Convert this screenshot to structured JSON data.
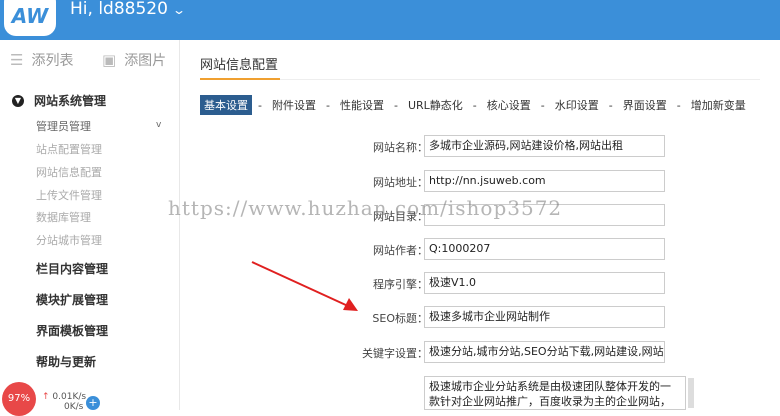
{
  "topbar": {
    "logo_text": "AW",
    "greeting": "Hi, ld88520",
    "chevron": "⌄"
  },
  "sidebar": {
    "quick_links": [
      {
        "label": "添列表",
        "icon": "list-icon"
      },
      {
        "label": "添图片",
        "icon": "image-icon"
      }
    ],
    "active_menu": {
      "label": "网站系统管理",
      "icon": "chevron-circle-icon",
      "items": [
        "管理员管理",
        "站点配置管理",
        "网站信息配置",
        "上传文件管理",
        "数据库管理",
        "分站城市管理"
      ],
      "marker": "v"
    },
    "groups": [
      "栏目内容管理",
      "模块扩展管理",
      "界面模板管理",
      "帮助与更新"
    ]
  },
  "status": {
    "percent": "97%",
    "speed": "0.01K/s",
    "speed2": "0K/s"
  },
  "main": {
    "title": "网站信息配置",
    "tabs": [
      "基本设置",
      "附件设置",
      "性能设置",
      "URL静态化",
      "核心设置",
      "水印设置",
      "界面设置",
      "增加新变量"
    ],
    "tab_sep": "-",
    "fields": [
      {
        "label": "网站名称：",
        "value": "多城市企业源码,网站建设价格,网站出租"
      },
      {
        "label": "网站地址：",
        "value": "http://nn.jsuweb.com"
      },
      {
        "label": "网站目录：",
        "value": ""
      },
      {
        "label": "网站作者：",
        "value": "Q:1000207"
      },
      {
        "label": "程序引擎：",
        "value": "极速V1.0"
      },
      {
        "label": "SEO标题：",
        "value": "极速多城市企业网站制作"
      },
      {
        "label": "关键字设置：",
        "value": "极速分站,城市分站,SEO分站下载,网站建设,网站推广"
      }
    ],
    "description": "极速城市企业分站系统是由极速团队整体开发的一款针对企业网站推广，百度收录为主的企业网站，网站增加内容可以"
  },
  "watermark": "https://www.huzhan.com/ishop3572",
  "colors": {
    "topbar": "#3b8fd9",
    "accent": "#f0a030",
    "active_tab": "#2c5d8f",
    "arrow": "#e02020"
  }
}
